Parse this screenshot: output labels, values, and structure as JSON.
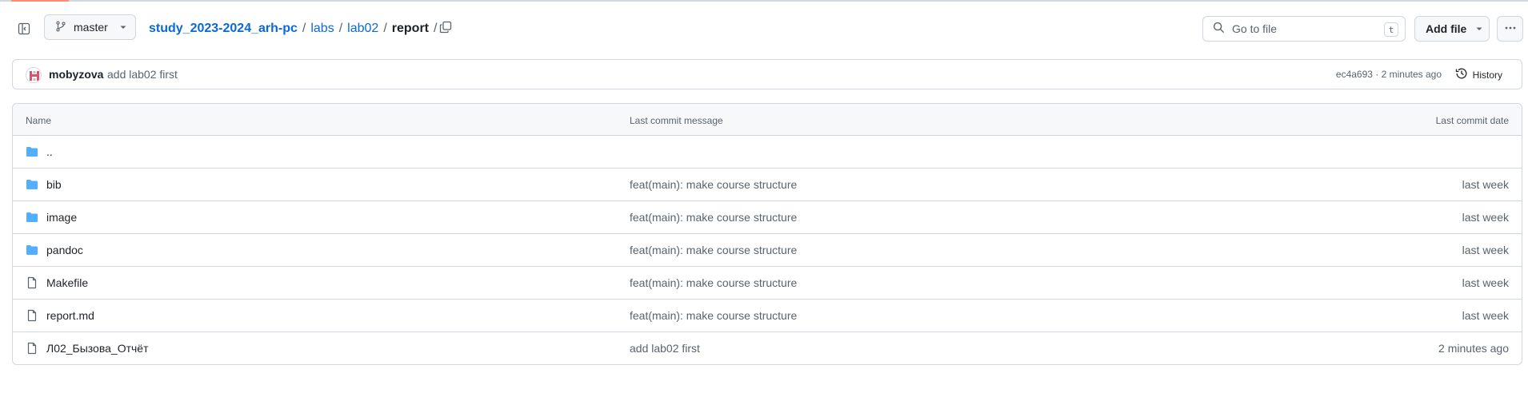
{
  "colors": {
    "accent": "#0969da",
    "folder": "#54aeff",
    "muted": "#59636e",
    "border": "#d0d7de",
    "tab_underline": "#fd8c73"
  },
  "header": {
    "branch": "master",
    "breadcrumb": {
      "repo": "study_2023-2024_arh-pc",
      "seg1": "labs",
      "seg2": "lab02",
      "current": "report",
      "sep": "/"
    },
    "search": {
      "placeholder": "Go to file",
      "shortcut": "t"
    },
    "add_file": "Add file"
  },
  "commit": {
    "author": "mobyzova",
    "message": "add lab02 first",
    "meta": "ec4a693 · 2 minutes ago",
    "history": "History"
  },
  "table": {
    "columns": {
      "name": "Name",
      "message": "Last commit message",
      "date": "Last commit date"
    },
    "rows": [
      {
        "icon": "folder-icon",
        "name": "..",
        "message": "",
        "date": ""
      },
      {
        "icon": "folder-icon",
        "name": "bib",
        "message": "feat(main): make course structure",
        "date": "last week"
      },
      {
        "icon": "folder-icon",
        "name": "image",
        "message": "feat(main): make course structure",
        "date": "last week"
      },
      {
        "icon": "folder-icon",
        "name": "pandoc",
        "message": "feat(main): make course structure",
        "date": "last week"
      },
      {
        "icon": "file-icon",
        "name": "Makefile",
        "message": "feat(main): make course structure",
        "date": "last week"
      },
      {
        "icon": "file-icon",
        "name": "report.md",
        "message": "feat(main): make course structure",
        "date": "last week"
      },
      {
        "icon": "file-icon",
        "name": "Л02_Бызова_Отчёт",
        "message": "add lab02 first",
        "date": "2 minutes ago"
      }
    ]
  }
}
